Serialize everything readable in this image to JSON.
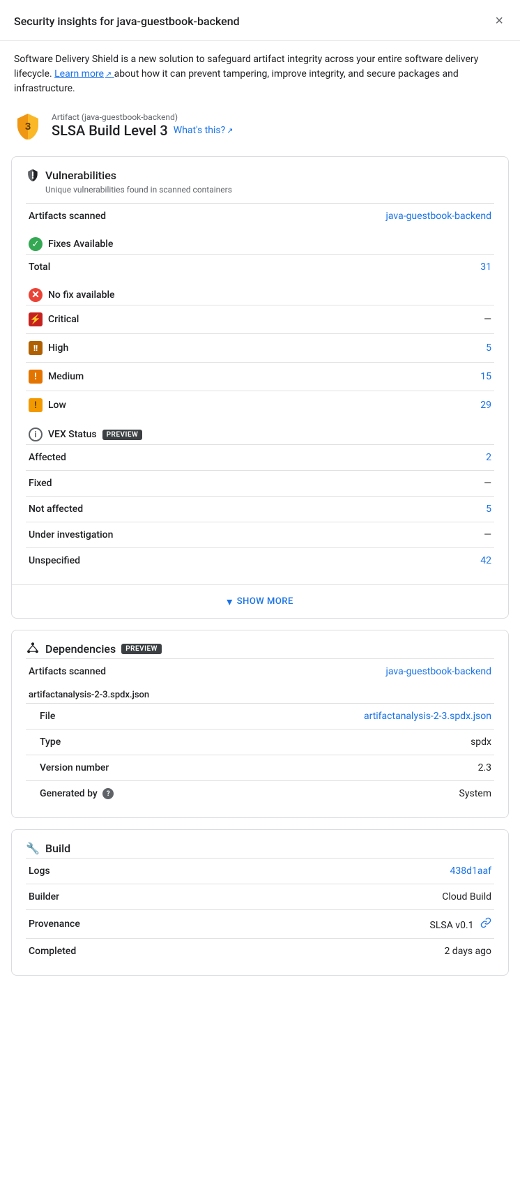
{
  "header": {
    "title": "Security insights for java-guestbook-backend",
    "close_label": "×"
  },
  "intro": {
    "text": "Software Delivery Shield is a new solution to safeguard artifact integrity across your entire software delivery lifecycle.",
    "link_text": "Learn more",
    "text2": "about how it can prevent tampering, improve integrity, and secure packages and infrastructure."
  },
  "slsa": {
    "artifact_label": "Artifact (java-guestbook-backend)",
    "level_text": "SLSA Build Level 3",
    "whats_this": "What's this?",
    "badge_number": "3"
  },
  "vulnerabilities": {
    "title": "Vulnerabilities",
    "subtitle": "Unique vulnerabilities found in scanned containers",
    "artifacts_scanned_label": "Artifacts scanned",
    "artifacts_scanned_link": "java-guestbook-backend",
    "fixes_available": {
      "title": "Fixes Available",
      "total_label": "Total",
      "total_value": "31"
    },
    "no_fix": {
      "title": "No fix available",
      "critical_label": "Critical",
      "critical_value": "—",
      "high_label": "High",
      "high_value": "5",
      "medium_label": "Medium",
      "medium_value": "15",
      "low_label": "Low",
      "low_value": "29"
    },
    "vex_status": {
      "title": "VEX Status",
      "preview_label": "PREVIEW",
      "affected_label": "Affected",
      "affected_value": "2",
      "fixed_label": "Fixed",
      "fixed_value": "—",
      "not_affected_label": "Not affected",
      "not_affected_value": "5",
      "under_investigation_label": "Under investigation",
      "under_investigation_value": "—",
      "unspecified_label": "Unspecified",
      "unspecified_value": "42"
    },
    "show_more": "SHOW MORE"
  },
  "dependencies": {
    "title": "Dependencies",
    "preview_label": "PREVIEW",
    "artifacts_scanned_label": "Artifacts scanned",
    "artifacts_scanned_link": "java-guestbook-backend",
    "artifact_group": "artifactanalysis-2-3.spdx.json",
    "file_label": "File",
    "file_value": "artifactanalysis-2-3.spdx.json",
    "type_label": "Type",
    "type_value": "spdx",
    "version_label": "Version number",
    "version_value": "2.3",
    "generated_by_label": "Generated by",
    "generated_by_value": "System"
  },
  "build": {
    "title": "Build",
    "logs_label": "Logs",
    "logs_value": "438d1aaf",
    "builder_label": "Builder",
    "builder_value": "Cloud Build",
    "provenance_label": "Provenance",
    "provenance_value": "SLSA v0.1",
    "completed_label": "Completed",
    "completed_value": "2 days ago"
  },
  "icons": {
    "close": "×",
    "check": "✓",
    "x_circle": "✕",
    "info": "i",
    "chevron_down": "▾",
    "bolt": "⚡",
    "exclamation": "!",
    "deps": "⠿",
    "wrench": "🔧",
    "external_link": "↗",
    "chain": "⛓",
    "help": "?"
  }
}
